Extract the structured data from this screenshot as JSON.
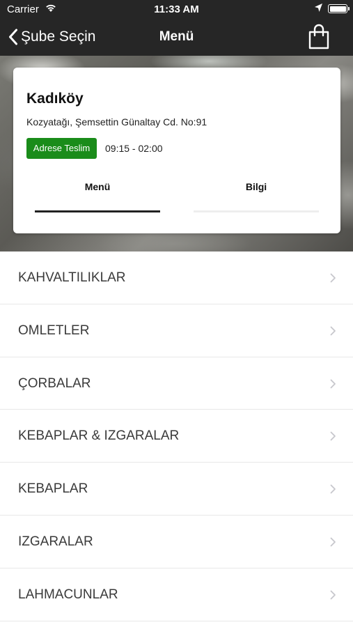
{
  "status": {
    "carrier": "Carrier",
    "time": "11:33 AM"
  },
  "nav": {
    "back_label": "Şube Seçin",
    "title": "Menü"
  },
  "store": {
    "name": "Kadıköy",
    "address": "Kozyatağı, Şemsettin Günaltay Cd. No:91",
    "badge": "Adrese Teslim",
    "hours": "09:15 - 02:00",
    "tabs": [
      {
        "label": "Menü",
        "active": true
      },
      {
        "label": "Bilgi",
        "active": false
      }
    ]
  },
  "categories": [
    {
      "label": "KAHVALTILIKLAR"
    },
    {
      "label": "OMLETLER"
    },
    {
      "label": "ÇORBALAR"
    },
    {
      "label": "KEBAPLAR & IZGARALAR"
    },
    {
      "label": "KEBAPLAR"
    },
    {
      "label": "IZGARALAR"
    },
    {
      "label": "LAHMACUNLAR"
    }
  ],
  "colors": {
    "bar": "#262626",
    "badge": "#1a8c1a",
    "chevron": "#c7c7cc"
  },
  "icons": {
    "back": "chevron-left-icon",
    "cart": "shopping-bag-icon",
    "row": "chevron-right-icon"
  }
}
